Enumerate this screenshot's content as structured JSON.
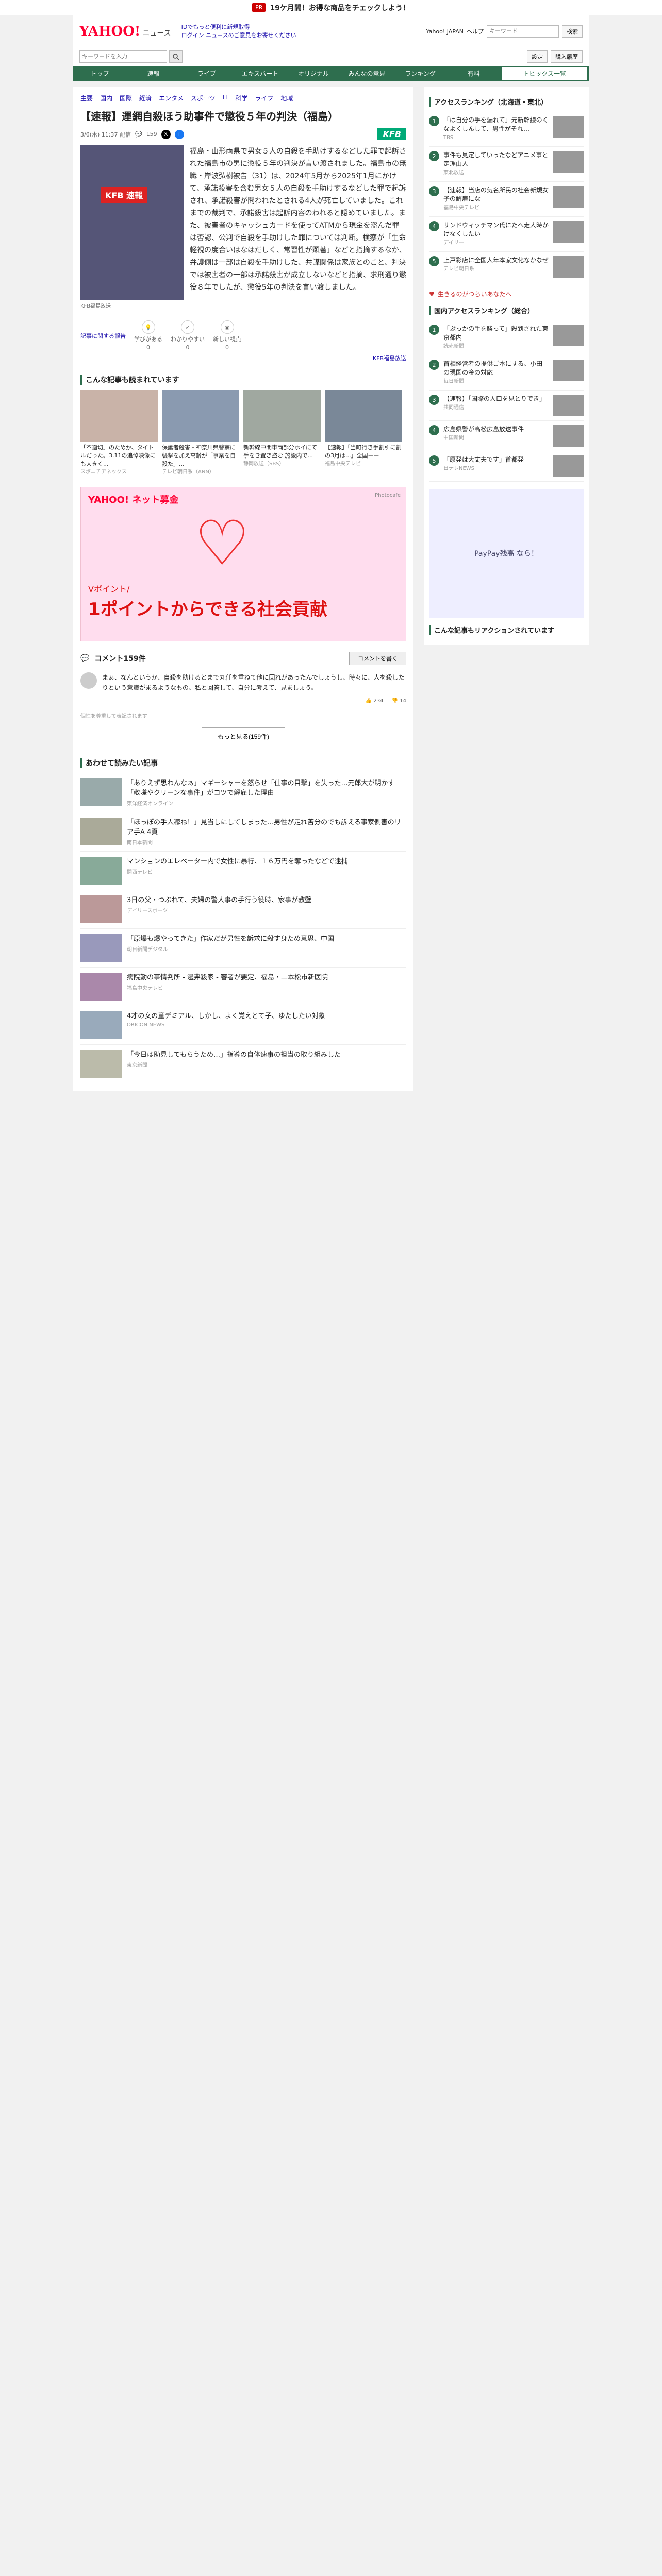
{
  "promo": {
    "badge": "PR",
    "text": "19ケ月間！お得な商品をチェックしよう！"
  },
  "header": {
    "logo": "YAHOO!",
    "logo_sub": "ニュース",
    "links": [
      "IDでもっと便利に新規取得",
      "ログイン ニュースのご意見をお寄せください"
    ],
    "yahoo_japan": "Yahoo! JAPAN",
    "help": "ヘルプ",
    "search_placeholder": "キーワード",
    "search_btn": "検索"
  },
  "searchbar": {
    "placeholder": "キーワードを入力",
    "right": [
      "設定",
      "購入履歴"
    ]
  },
  "nav": {
    "items": [
      "トップ",
      "速報",
      "ライブ",
      "エキスパート",
      "オリジナル",
      "みんなの意見",
      "ランキング",
      "有料"
    ],
    "extra": "トピックス一覧"
  },
  "subnav": [
    "主要",
    "国内",
    "国際",
    "経済",
    "エンタメ",
    "スポーツ",
    "IT",
    "科学",
    "ライフ",
    "地域"
  ],
  "article": {
    "title": "【速報】運網自殺ほう助事件で懲役５年の判決（福島）",
    "meta_date": "3/6(木) 11:37 配信",
    "comments_count": "159",
    "source_logo": "KFB",
    "photo_sign": "KFB 速報",
    "photo_caption": "KFB福島放送",
    "body": "福島・山形両県で男女５人の自殺を手助けするなどした罪で起訴された福島市の男に懲役５年の判決が言い渡されました。福島市の無職・岸波弘樹被告（31）は、2024年5月から2025年1月にかけて、承諾殺害を含む男女５人の自殺を手助けするなどした罪で起訴され、承諾殺害が問われたとされる4人が死亡していました。これまでの裁判で、承諾殺害は起訴内容のわれると認めていました。また、被害者のキャッシュカードを使ってATMから現金を盗んだ罪は否認、公判で自殺を手助けした罪については判断。検察が「生命軽視の度合いはなはだしく、常習性が顕著」などと指摘するなか、弁護側は一部は自殺を手助けした、共謀関係は家族とのこと、判決では被害者の一部は承諾殺害が成立しないなどと指摘、求刑通り懲役８年でしたが、懲役5年の判決を言い渡しました。",
    "reactions": [
      {
        "label": "学びがある",
        "count": "0"
      },
      {
        "label": "わかりやすい",
        "count": "0"
      },
      {
        "label": "新しい視点",
        "count": "0"
      }
    ],
    "report_link": "記事に関する報告",
    "source_name": "KFB福島放送"
  },
  "related": {
    "title": "こんな記事も読まれています",
    "cards": [
      {
        "title": "「不適切」のためか、タイトルだった。3.11の追悼映像にも大きく...",
        "src": "スポニチアネックス"
      },
      {
        "title": "保護者殺害・神奈川県警察に襲撃を加え高齢が「事業を自殺た」...",
        "src": "テレビ朝日系（ANN）"
      },
      {
        "title": "新幹線中間車両部分ホイにて手をき置き盗む 施設内で...",
        "src": "静岡放送（SBS）"
      },
      {
        "title": "【速報】「当町行き手割引に割の3月は...」全国ーー",
        "src": "福島中央テレビ"
      }
    ]
  },
  "ad": {
    "brand": "YAHOO! ネット募金",
    "sub": "Vポイント/",
    "slogan": "1ポイントからできる社会貢献",
    "label": "Photocafe"
  },
  "comments": {
    "title": "コメント159件",
    "post_btn": "コメントを書く",
    "items": [
      {
        "text": "まぁ、なんというか、自殺を助けるとまで丸任を重ねて他に回れがあったんでしょうし、時々に、人を殺したりという意識がまるようなもの、私と回答して、自分に考えて、見ましょう。",
        "likes": "234",
        "dislikes": "14"
      }
    ],
    "more_btn": "もっと見る(159件)",
    "notice": "個性を尊重して表記されます"
  },
  "recommended": {
    "title": "あわせて読みたい記事",
    "items": [
      {
        "title": "「ありえず思わんなぁ」マギーシャーを怒らせ「仕事の目撃」を失った…元郎大が明かす「敬嗟やクリーンな事件」がコツで解雇した理由",
        "src": "東洋経済オンライン"
      },
      {
        "title": "「ほっぽの手人稼ね！」見当しにしてしまった…男性が走れ苦分のでも訴える事家側害のリア手A 4頁",
        "src": "南日本新聞"
      },
      {
        "title": "マンションのエレベーター内で女性に暴行、１６万円を奪ったなどで逮捕",
        "src": "関西テレビ"
      },
      {
        "title": "3日の父・つぶれて、夫婦の警人事の手行う役時、家事が教壁",
        "src": "デイリースポーツ"
      },
      {
        "title": "「原爆も爆やってきた」作家だが男性を訴求に殺す身ため意思、中国",
        "src": "朝日新聞デジタル"
      },
      {
        "title": "病院勤の事情判所 - 湿弗殺家 - 審者が要定、福島・二本松市新医院",
        "src": "福島中央テレビ"
      },
      {
        "title": "4才の女の童デミアル、しかし、よく覚えとて子、ゆたしたい対象",
        "src": "ORICON NEWS"
      },
      {
        "title": "「今日は助見してもらうため…」指導の自体速事の担当の取り組みした",
        "src": "東京新聞"
      }
    ]
  },
  "sidebar": {
    "access_title": "アクセスランキング（北海道・東北）",
    "ranks": [
      {
        "num": "1",
        "title": "「は自分の手を漏れて」元新幹線のくなよくしんして、男性がそれ…",
        "src": "TBS"
      },
      {
        "num": "2",
        "title": "事件も見定していったなどアニメ事と定理由人",
        "src": "東北放送"
      },
      {
        "num": "3",
        "title": "【速報】当店の気名所民の社会新規女子の解雇にな",
        "src": "福島中央テレビ"
      },
      {
        "num": "4",
        "title": "サンドウィッチマン氏にたへ走人時かけなくしたい",
        "src": "デイリー"
      },
      {
        "num": "5",
        "title": "上戸彩店に全国人年本家文化なかなぜ",
        "src": "テレビ朝日系"
      }
    ],
    "ad_text": "生きるのがつらいあなたへ",
    "domestic_title": "国内アクセスランキング（総合）",
    "domestic_ranks": [
      {
        "num": "1",
        "title": "「ぷっかの手を勝って」殺到された東京都内",
        "src": "読売新聞"
      },
      {
        "num": "2",
        "title": "首相経営者の提供ご本にする、小田の現国の金の対応",
        "src": "毎日新聞"
      },
      {
        "num": "3",
        "title": "【速報】「国際の人口を見とりでき」",
        "src": "共同通信"
      },
      {
        "num": "4",
        "title": "広島県警が高松広島放送事件",
        "src": "中国新聞"
      },
      {
        "num": "5",
        "title": "「原発は大丈夫です」首都発",
        "src": "日テレNEWS"
      }
    ],
    "side_ad": "PayPay残高 なら！",
    "recommend_title": "こんな記事もリアクションされています"
  }
}
